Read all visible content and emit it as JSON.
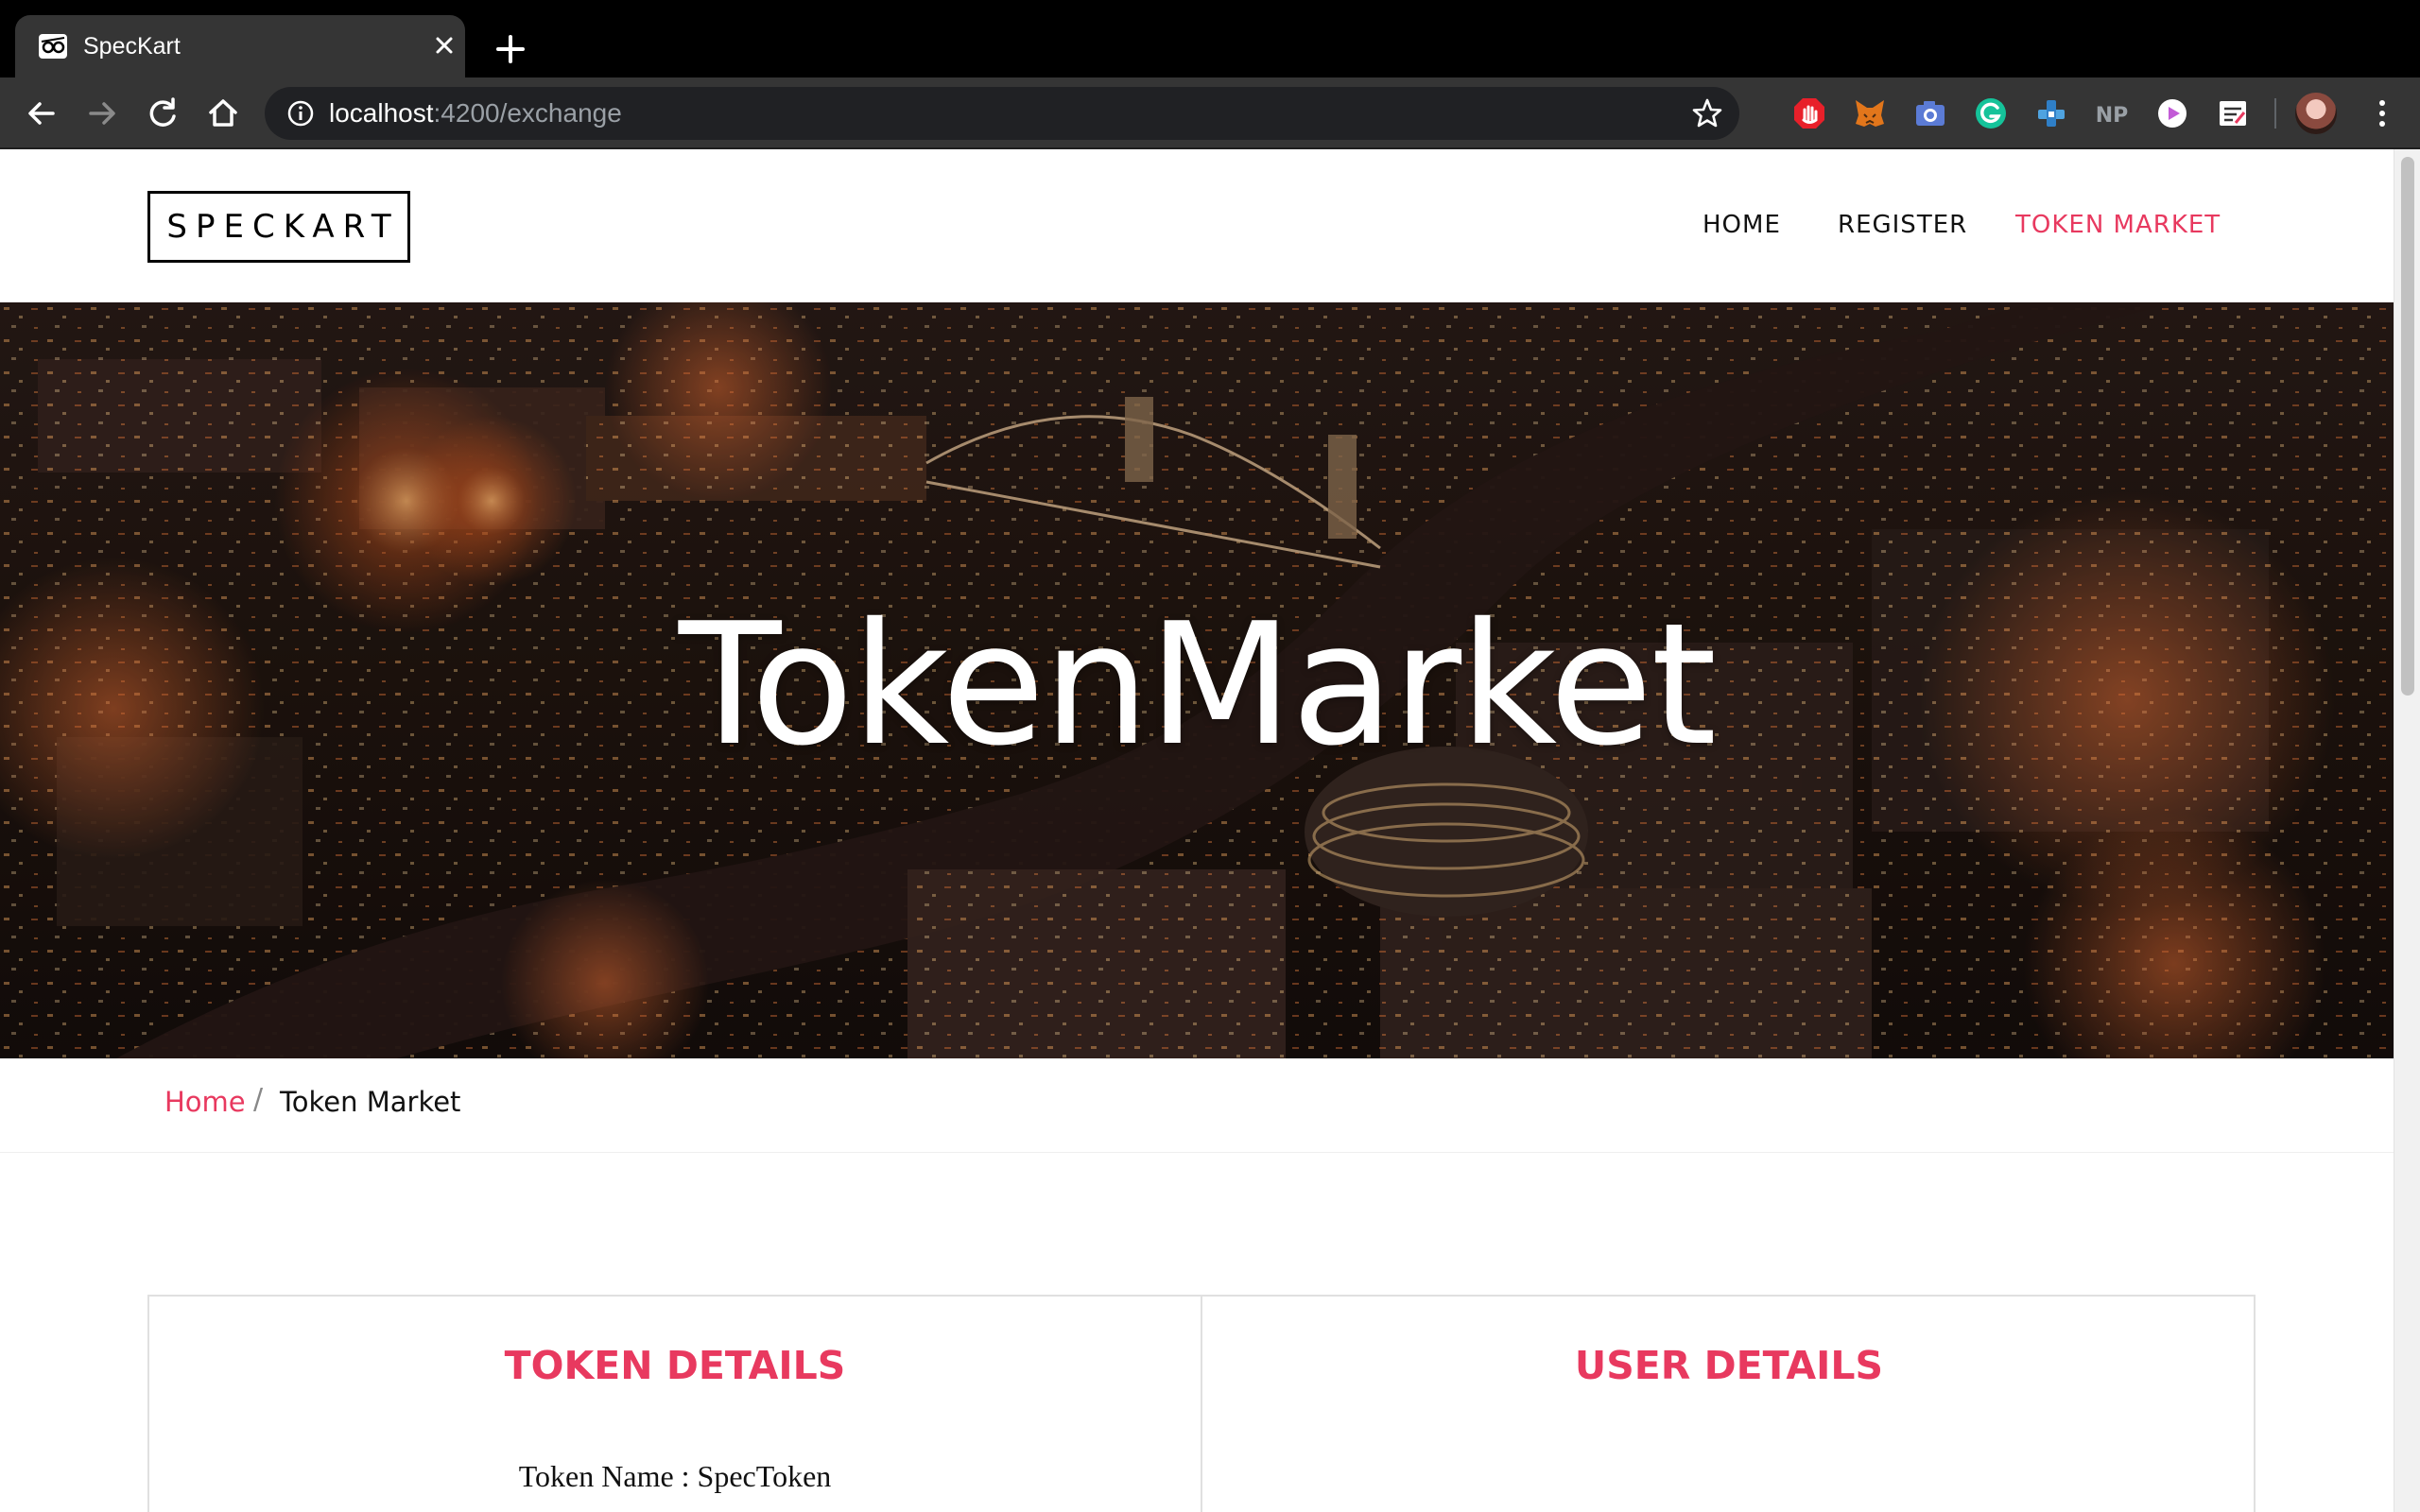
{
  "browser": {
    "tab_title": "SpecKart",
    "url_host": "localhost",
    "url_path": ":4200/exchange",
    "extensions": [
      "adblock-icon",
      "metamask-icon",
      "camera-icon",
      "grammarly-icon",
      "puzzle-extension-icon",
      "np-extension-icon",
      "media-player-icon",
      "notes-extension-icon"
    ],
    "np_label": "NP"
  },
  "site": {
    "logo": "SPECKART",
    "nav": {
      "home": "HOME",
      "register": "REGISTER",
      "token_market": "TOKEN MARKET"
    }
  },
  "hero": {
    "title": "TokenMarket"
  },
  "breadcrumb": {
    "home": "Home",
    "separator": "/",
    "current": "Token Market"
  },
  "token_panel": {
    "title": "TOKEN DETAILS",
    "token_name": "Token Name : SpecToken"
  },
  "user_panel": {
    "title": "USER DETAILS"
  },
  "colors": {
    "accent": "#e8395f",
    "chrome_dark": "#353535",
    "omnibox": "#202124"
  }
}
